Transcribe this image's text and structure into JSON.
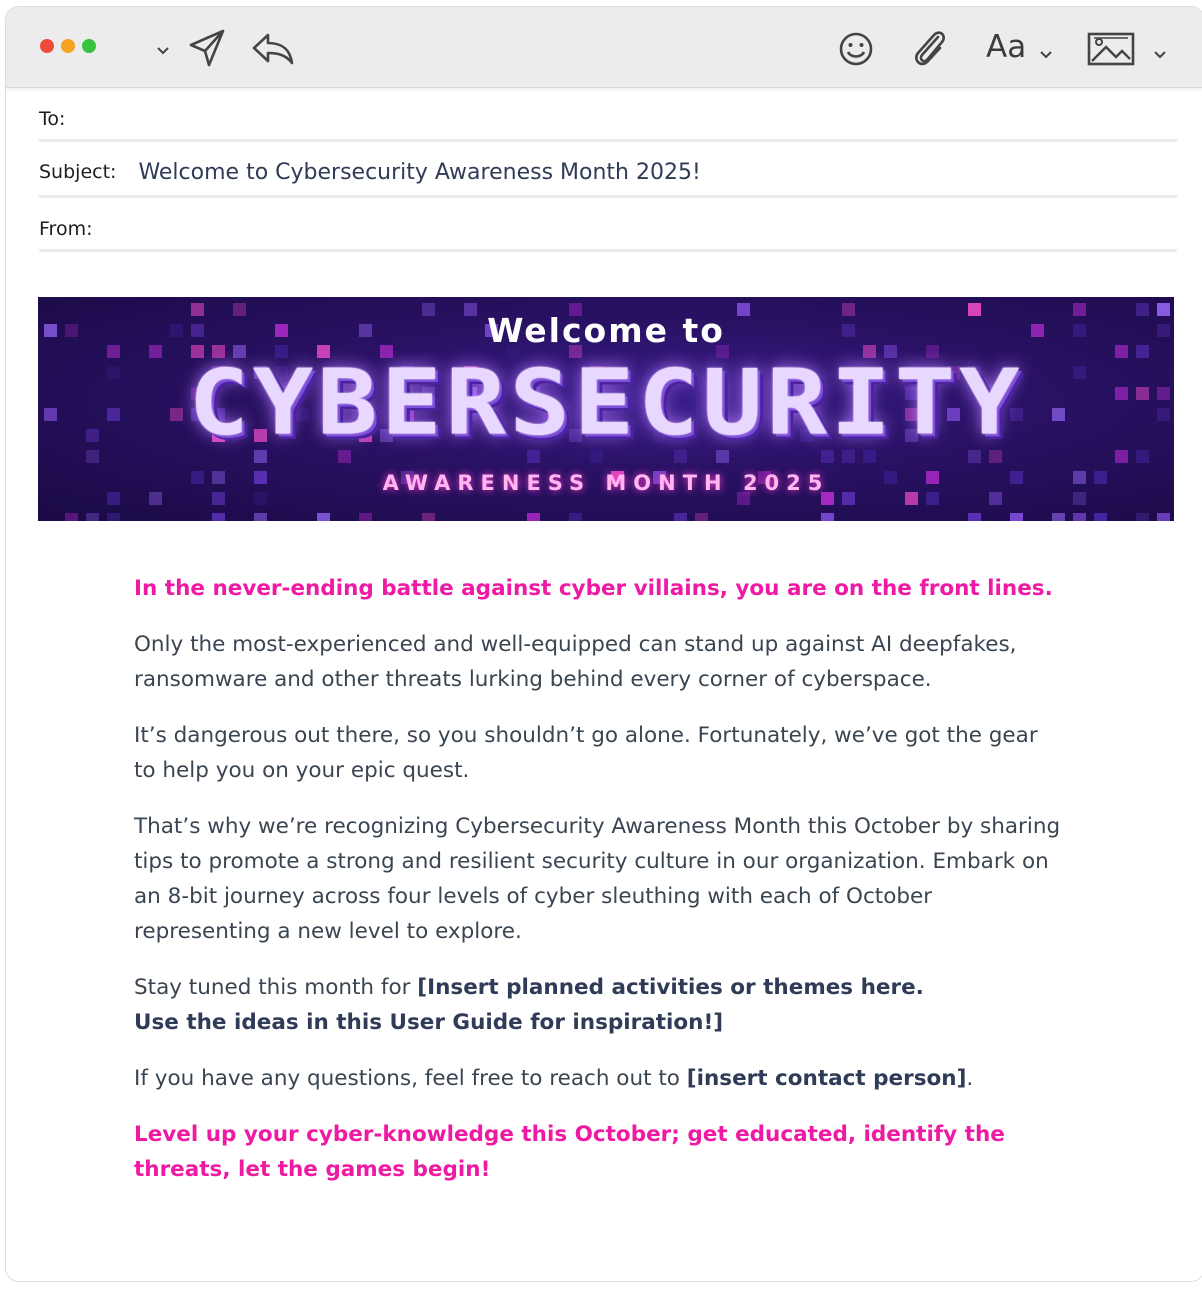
{
  "toolbar": {
    "traffic_lights": [
      "#f04a3a",
      "#f4a21f",
      "#38c33f"
    ],
    "icons": [
      "chevron-down-icon",
      "send-icon",
      "reply-icon",
      "emoji-icon",
      "paperclip-icon",
      "chevron-down-icon",
      "image-icon",
      "chevron-down-icon"
    ],
    "font_label": "Aa"
  },
  "header": {
    "to_label": "To:",
    "to_value": "",
    "subject_label": "Subject:",
    "subject_value": "Welcome to Cybersecurity Awareness Month 2025!",
    "from_label": "From:",
    "from_value": ""
  },
  "banner": {
    "welcome": "Welcome to",
    "title": "CYBERSECURITY",
    "subtitle": "AWARENESS MONTH 2025"
  },
  "body": {
    "intro": "In the never-ending battle against cyber villains, you are on the front lines.",
    "p1": "Only the most-experienced and well-equipped can stand up against AI deepfakes, ransomware and other threats lurking behind every corner of cyberspace.",
    "p2": "It’s dangerous out there, so you shouldn’t go alone. Fortunately, we’ve got the gear to help you on your epic quest.",
    "p3": "That’s why we’re recognizing Cybersecurity Awareness Month this October by sharing tips to promote a strong and resilient security culture in our organization. Embark on an 8-bit journey across four levels of cyber sleuthing with each of October representing a new level to explore.",
    "p4_prefix": "Stay tuned this month for ",
    "p4_strong": "[Insert planned activities or themes here.",
    "p4_strong2": "Use the ideas in this User Guide for inspiration!]",
    "p5_prefix": "If you have any questions, feel free to reach out to ",
    "p5_strong": "[insert contact person]",
    "p5_suffix": ".",
    "outro": "Level up your cyber-knowledge this October; get educated, identify the threats, let the games begin!"
  },
  "colors": {
    "accent_pink": "#ef1aa3",
    "body_text": "#3a4552",
    "banner_bg": "#2a1266"
  }
}
